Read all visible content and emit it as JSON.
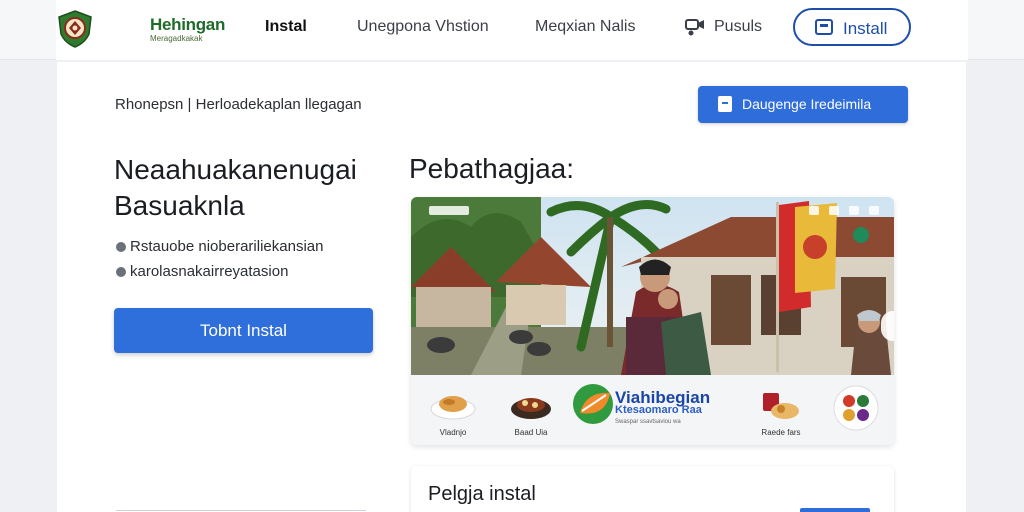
{
  "brand": {
    "name": "Hehingan",
    "tagline": "Meragadkakak",
    "logo_icon": "shield-emblem-icon"
  },
  "nav": {
    "links": [
      "Instal",
      "Unegpona Vhstion",
      "Meqxian Nalis",
      "Pusuls"
    ],
    "active": "Instal",
    "install_label": "Install"
  },
  "notice": {
    "text": "Rhonepsn | Herloadekaplan llegagan",
    "action_label": "Daugenge Iredeimila"
  },
  "hero": {
    "headline_line1": "Neaahuakanenugai",
    "headline_line2": "Basuaknla",
    "bullets": [
      "Rstauobe nioberariliekansian",
      "karolasnakairreyatasion"
    ],
    "primary_label": "Tobnt Instal"
  },
  "preview": {
    "title": "Pebathagjaa:",
    "thumbs": [
      {
        "caption": "Vladnjo",
        "icon": "pastry-plate-icon"
      },
      {
        "caption": "Baad Uia",
        "icon": "rendang-plate-icon"
      },
      {
        "caption": "Raede fars",
        "icon": "sweets-plate-icon"
      }
    ],
    "promo": {
      "title": "Viahibegian",
      "subtitle": "Ktesaomaro Raa",
      "note": "Swaspar ssavtsaviou wa",
      "logo_icon": "green-orange-leaf-logo-icon"
    }
  },
  "bottom": {
    "title": "Pelgja instal"
  },
  "colors": {
    "accent": "#2f6ddb",
    "nav_border": "#1e4fa8",
    "brand_green": "#1f6b2a"
  }
}
